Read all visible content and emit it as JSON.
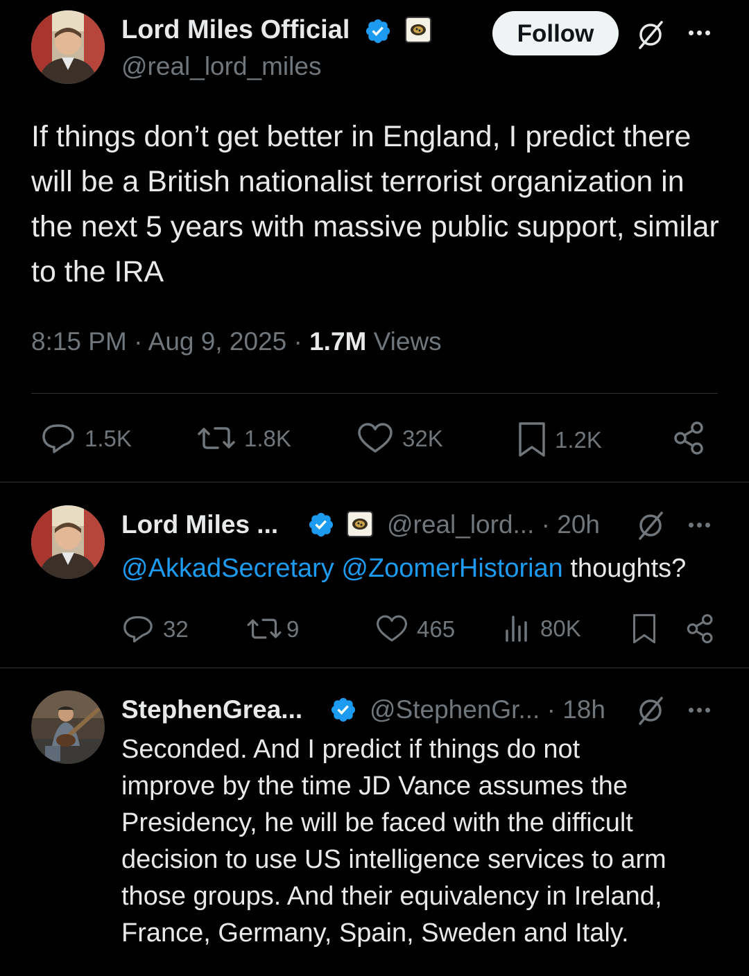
{
  "main_tweet": {
    "author_name": "Lord Miles Official",
    "handle": "@real_lord_miles",
    "follow_label": "Follow",
    "text": "If things don’t get better in England, I predict there will be a British nationalist terrorist organization in the next 5 years with massive public support, similar to the IRA",
    "time": "8:15 PM",
    "date": "Aug 9, 2025",
    "views_count": "1.7M",
    "views_label": "Views",
    "separator": "·",
    "stats": {
      "replies": "1.5K",
      "reposts": "1.8K",
      "likes": "32K",
      "bookmarks": "1.2K"
    }
  },
  "replies": [
    {
      "author_name": "Lord Miles ...",
      "handle": "@real_lord...",
      "separator": "·",
      "time": "20h",
      "mention_1": "@AkkadSecretary",
      "mention_2": "@ZoomerHistorian",
      "text": "thoughts?",
      "stats": {
        "replies": "32",
        "reposts": "9",
        "likes": "465",
        "views": "80K"
      }
    },
    {
      "author_name": "StephenGrea...",
      "handle": "@StephenGr...",
      "separator": "·",
      "time": "18h",
      "text_lines": [
        "Seconded.  And I predict if things do not",
        "improve by the time JD Vance assumes the",
        "Presidency, he will be faced with the difficult",
        "decision to use US intelligence services to arm",
        "those groups.  And their equivalency in Ireland,",
        "France, Germany, Spain, Sweden and Italy."
      ]
    }
  ],
  "colors": {
    "background": "#000000",
    "text": "#e7e9ea",
    "muted": "#71767b",
    "link": "#1d9bf0",
    "verified": "#1d9bf0",
    "divider": "#2f3336",
    "follow_bg": "#eff3f4"
  },
  "icons": [
    "verified-badge-icon",
    "affiliate-badge-icon",
    "grok-icon",
    "more-icon",
    "reply-icon",
    "repost-icon",
    "like-icon",
    "bookmark-icon",
    "share-icon",
    "views-icon"
  ]
}
